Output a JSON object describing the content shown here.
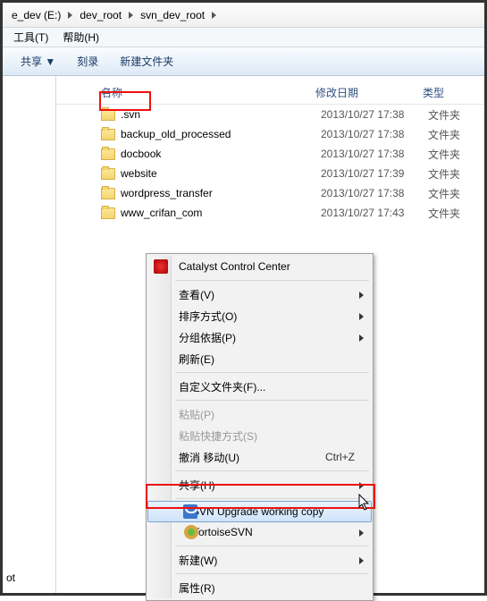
{
  "breadcrumb": {
    "items": [
      "e_dev (E:)",
      "dev_root",
      "svn_dev_root"
    ]
  },
  "menubar": {
    "tools": "工具(T)",
    "help": "帮助(H)"
  },
  "toolbar": {
    "share": "共享 ▼",
    "burn": "刻录",
    "newfolder": "新建文件夹"
  },
  "columns": {
    "name": "名称",
    "date": "修改日期",
    "type": "类型"
  },
  "rows": [
    {
      "name": ".svn",
      "date": "2013/10/27 17:38",
      "type": "文件夹"
    },
    {
      "name": "backup_old_processed",
      "date": "2013/10/27 17:38",
      "type": "文件夹"
    },
    {
      "name": "docbook",
      "date": "2013/10/27 17:38",
      "type": "文件夹"
    },
    {
      "name": "website",
      "date": "2013/10/27 17:39",
      "type": "文件夹"
    },
    {
      "name": "wordpress_transfer",
      "date": "2013/10/27 17:38",
      "type": "文件夹"
    },
    {
      "name": "www_crifan_com",
      "date": "2013/10/27 17:43",
      "type": "文件夹"
    }
  ],
  "sidebar": {
    "bottom": "ot"
  },
  "context": {
    "ccc": "Catalyst Control Center",
    "view": "查看(V)",
    "sort": "排序方式(O)",
    "group": "分组依据(P)",
    "refresh": "刷新(E)",
    "customize": "自定义文件夹(F)...",
    "paste": "粘贴(P)",
    "pasteShortcut": "粘贴快捷方式(S)",
    "undo": "撤消 移动(U)",
    "undo_sc": "Ctrl+Z",
    "share": "共享(H)",
    "svnup": "SVN Upgrade working copy",
    "tsvn": "TortoiseSVN",
    "new": "新建(W)",
    "prop": "属性(R)"
  }
}
